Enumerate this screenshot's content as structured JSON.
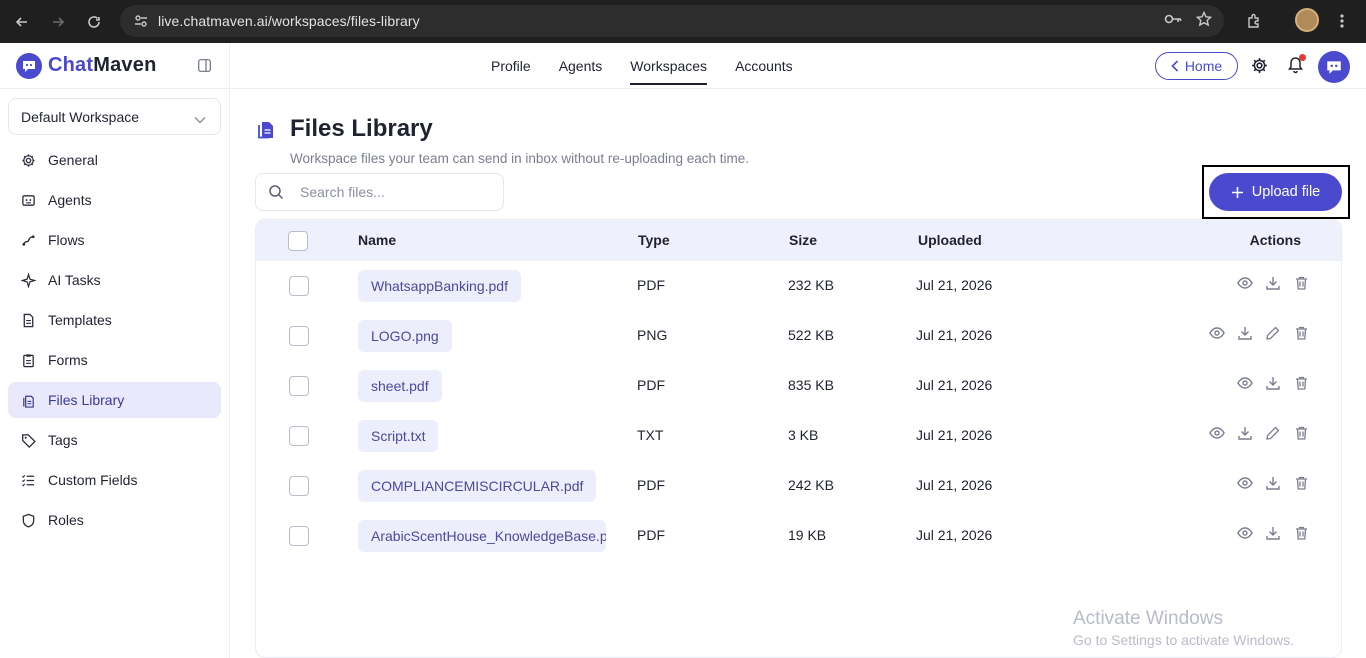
{
  "browser": {
    "url": "live.chatmaven.ai/workspaces/files-library"
  },
  "brand": {
    "name_part1": "Chat",
    "name_part2": "Maven"
  },
  "workspace_select": {
    "value": "Default Workspace"
  },
  "sidebar": {
    "items": [
      {
        "label": "General",
        "icon": "gear-icon"
      },
      {
        "label": "Agents",
        "icon": "agents-icon"
      },
      {
        "label": "Flows",
        "icon": "flows-icon"
      },
      {
        "label": "AI Tasks",
        "icon": "sparkle-icon"
      },
      {
        "label": "Templates",
        "icon": "document-icon"
      },
      {
        "label": "Forms",
        "icon": "clipboard-icon"
      },
      {
        "label": "Files Library",
        "icon": "files-icon",
        "active": true
      },
      {
        "label": "Tags",
        "icon": "tag-icon"
      },
      {
        "label": "Custom Fields",
        "icon": "list-icon"
      },
      {
        "label": "Roles",
        "icon": "shield-icon"
      }
    ]
  },
  "topnav": {
    "tabs": [
      "Profile",
      "Agents",
      "Workspaces",
      "Accounts"
    ],
    "active_tab": "Workspaces",
    "home_label": "Home"
  },
  "page": {
    "title": "Files Library",
    "subtitle": "Workspace files your team can send in inbox without re-uploading each time.",
    "search_placeholder": "Search files...",
    "upload_label": "Upload file"
  },
  "table": {
    "headers": {
      "name": "Name",
      "type": "Type",
      "size": "Size",
      "uploaded": "Uploaded",
      "actions": "Actions"
    },
    "rows": [
      {
        "name": "WhatsappBanking.pdf",
        "type": "PDF",
        "size": "232 KB",
        "uploaded": "Jul 21, 2026",
        "editable": false
      },
      {
        "name": "LOGO.png",
        "type": "PNG",
        "size": "522 KB",
        "uploaded": "Jul 21, 2026",
        "editable": true
      },
      {
        "name": "sheet.pdf",
        "type": "PDF",
        "size": "835 KB",
        "uploaded": "Jul 21, 2026",
        "editable": false
      },
      {
        "name": "Script.txt",
        "type": "TXT",
        "size": "3 KB",
        "uploaded": "Jul 21, 2026",
        "editable": true
      },
      {
        "name": "COMPLIANCEMISCIRCULAR.pdf",
        "type": "PDF",
        "size": "242 KB",
        "uploaded": "Jul 21, 2026",
        "editable": false
      },
      {
        "name": "ArabicScentHouse_KnowledgeBase.pdf",
        "type": "PDF",
        "size": "19 KB",
        "uploaded": "Jul 21, 2026",
        "editable": false
      }
    ]
  },
  "watermark": {
    "line1": "Activate Windows",
    "line2": "Go to Settings to activate Windows."
  },
  "colors": {
    "accent": "#4b4acf",
    "active_bg": "#e9e9fb",
    "header_bg": "#eef0fb"
  }
}
